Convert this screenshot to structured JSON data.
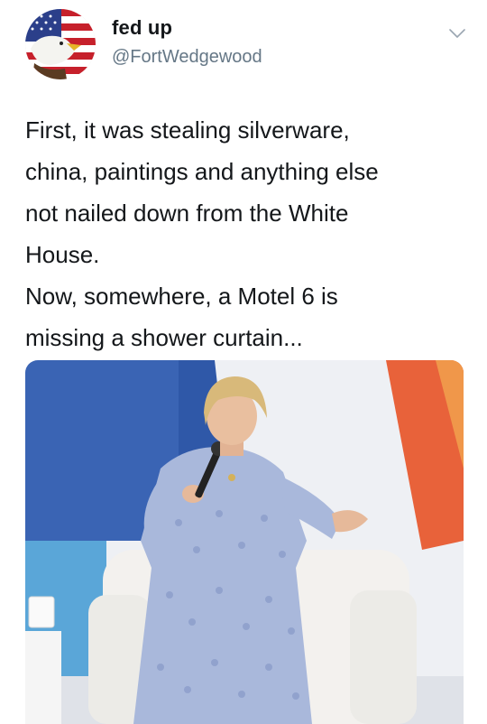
{
  "tweet": {
    "author": {
      "display_name": "fed up",
      "handle": "@FortWedgewood",
      "avatar_icon": "eagle-flag-avatar"
    },
    "menu_icon": "chevron-down-icon",
    "text_lines": [
      "First, it  was stealing silverware,",
      "china, paintings and anything else",
      "not nailed down from  the White",
      "House.",
      "Now, somewhere, a Motel 6 is",
      "missing a shower curtain..."
    ],
    "media": {
      "kind": "photo",
      "colors": {
        "backdrop_blue": "#3a64b4",
        "backdrop_orange": "#e8623a",
        "dress": "#a9b8db",
        "chair": "#f3f1ee"
      }
    }
  }
}
